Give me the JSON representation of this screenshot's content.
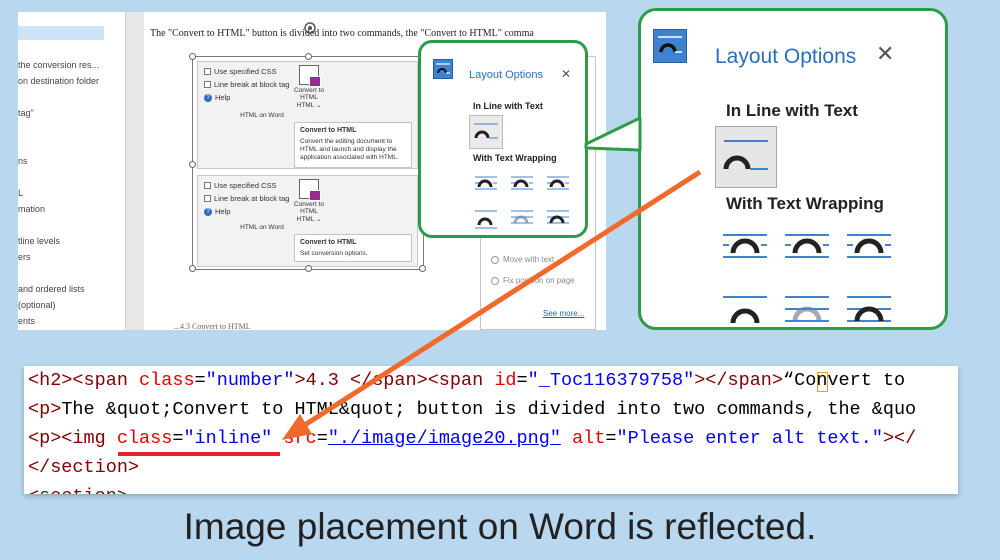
{
  "word": {
    "nav_items": [
      "the conversion res...",
      "on destination folder",
      "tag\"",
      "ns",
      "L",
      "mation",
      "tline levels",
      "ers",
      "and ordered lists",
      "(optional)",
      "ents"
    ],
    "doc_text": "The \"Convert to HTML\" button is divided into two commands, the \"Convert to HTML\" comma",
    "doc_bottom_text": "...4.3 Convert to HTML",
    "ribbon_top": {
      "use_css": "Use specified CSS",
      "line_break": "Line break at block tag",
      "help": "Help",
      "convert_label": "Convert to HTML",
      "convert_dropdown": "HTML ⌄",
      "group": "HTML on Word",
      "tooltip_title": "Convert to HTML",
      "tooltip_body": "Convert the editing document to HTML and launch and display the application associated with HTML."
    },
    "ribbon_bottom": {
      "use_css": "Use specified CSS",
      "line_break": "Line break at block tag",
      "help": "Help",
      "convert_label": "Convert to HTML",
      "convert_dropdown": "HTML ⌄",
      "group": "HTML on Word",
      "tooltip_title": "Convert to HTML",
      "tooltip_body": "Set conversion options."
    },
    "layout_panel": {
      "move_with_text": "Move with text",
      "fix_position": "Fix position on page",
      "see_more": "See more..."
    }
  },
  "layout_options": {
    "title": "Layout Options",
    "close": "✕",
    "inline_heading": "In Line with Text",
    "wrapping_heading": "With Text Wrapping"
  },
  "code": {
    "line1": {
      "open": "<h2><span ",
      "attr": "class",
      "eq": "=",
      "val": "\"number\"",
      "rest1": ">4.3 </span><span ",
      "attr2": "id",
      "val2": "\"_Toc116379758\"",
      "rest2": "></span>",
      "txt": "“Convert to"
    },
    "line2": {
      "open": "<p>",
      "txt": "The &quot;Convert to HTML&quot; button is divided into two commands, the &quo"
    },
    "line3": {
      "open": "<p><img ",
      "attr": "class",
      "val": "\"inline\"",
      "attr2": "src",
      "val2": "\"./image/image20.png\"",
      "attr3": "alt",
      "val3": "\"Please enter alt text.\"",
      "close": "></"
    },
    "line4": {
      "txt": "</section>"
    },
    "line5": {
      "txt": "<section>"
    }
  },
  "caption": "Image placement on Word is reflected.",
  "colors": {
    "background": "#b9d7ef",
    "accent_green": "#2e9b48",
    "arrow_orange": "#f06a2c",
    "underline_red": "#e8202a",
    "icon_blue": "#3f82cf"
  },
  "icons": [
    "layout-options-icon",
    "close-icon",
    "inline-wrap-icon",
    "square-wrap-icon",
    "tight-wrap-icon",
    "through-wrap-icon",
    "top-bottom-wrap-icon",
    "behind-text-icon",
    "in-front-of-text-icon",
    "help-icon",
    "convert-html-icon",
    "rotate-handle-icon"
  ]
}
